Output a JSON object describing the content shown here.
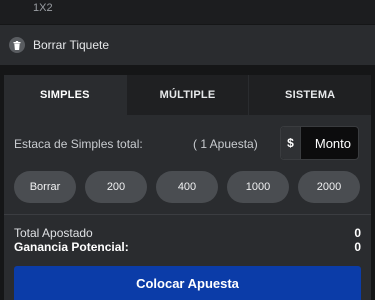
{
  "market": {
    "label": "1X2"
  },
  "clear_ticket": {
    "label": "Borrar Tiquete",
    "icon": "trash-icon"
  },
  "tabs": [
    {
      "label": "SIMPLES",
      "active": true
    },
    {
      "label": "MÚLTIPLE",
      "active": false
    },
    {
      "label": "SISTEMA",
      "active": false
    }
  ],
  "stake": {
    "label": "Estaca de Simples total:",
    "count_text": "( 1 Apuesta)",
    "currency": "$",
    "placeholder": "Monto"
  },
  "quick_amounts": [
    "Borrar",
    "200",
    "400",
    "1000",
    "2000"
  ],
  "summary": {
    "total_label": "Total Apostado",
    "total_value": "0",
    "potential_label": "Ganancia Potencial:",
    "potential_value": "0"
  },
  "place_bet": {
    "label": "Colocar Apuesta"
  },
  "colors": {
    "accent": "#0b3ca8",
    "panel": "#2a2c2f",
    "pill": "#4a4d51"
  }
}
